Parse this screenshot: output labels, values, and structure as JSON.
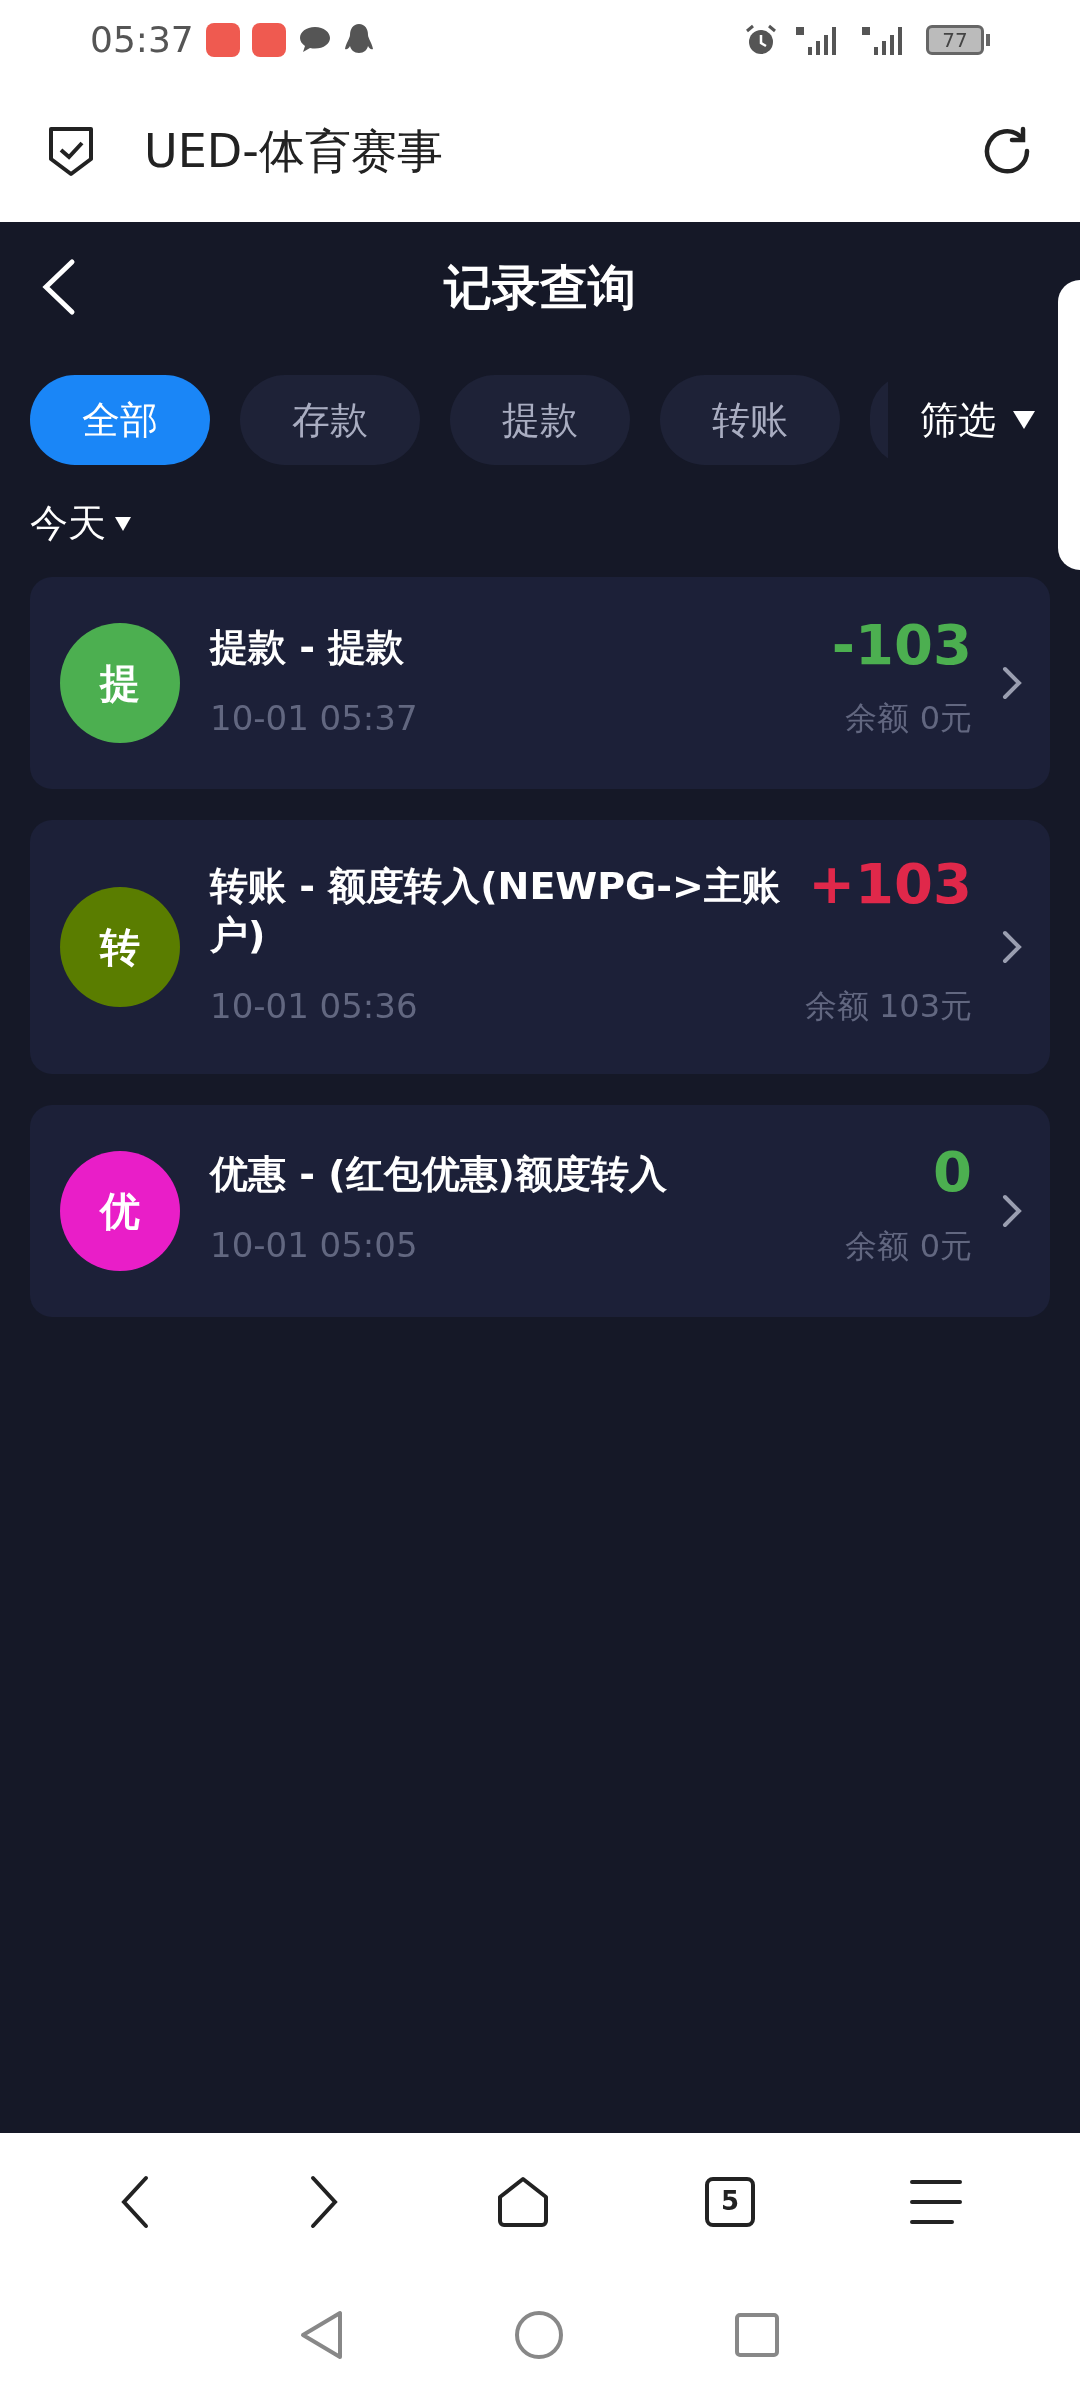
{
  "status_bar": {
    "time": "05:37",
    "battery": "77"
  },
  "browser": {
    "title": "UED-体育赛事"
  },
  "header": {
    "title": "记录查询"
  },
  "tabs": [
    {
      "label": "全部",
      "selected": true
    },
    {
      "label": "存款",
      "selected": false
    },
    {
      "label": "提款",
      "selected": false
    },
    {
      "label": "转账",
      "selected": false
    }
  ],
  "filter": {
    "label": "筛选"
  },
  "date_filter": {
    "label": "今天"
  },
  "records": [
    {
      "badge": "提",
      "color": "#4caf50",
      "title": "提款 - 提款",
      "time": "10-01 05:37",
      "amount": "-103",
      "kind": "debit",
      "balance": "余额 0元"
    },
    {
      "badge": "转",
      "color": "#5a7d00",
      "title": "转账 - 额度转入(NEWPG->主账户)",
      "time": "10-01 05:36",
      "amount": "+103",
      "kind": "credit",
      "balance": "余额 103元"
    },
    {
      "badge": "优",
      "color": "#e91ec8",
      "title": "优惠 - (红包优惠)额度转入",
      "time": "10-01 05:05",
      "amount": "0",
      "kind": "debit",
      "balance": "余额 0元"
    }
  ],
  "bottom_bar": {
    "tab_count": "5"
  }
}
